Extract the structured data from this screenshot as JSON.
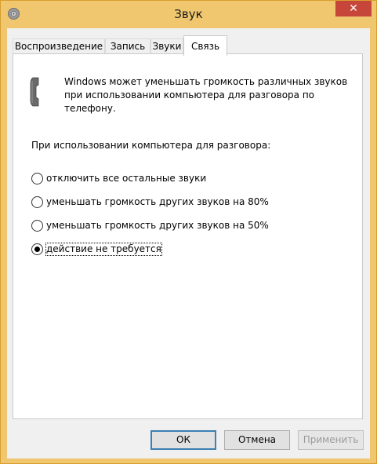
{
  "window": {
    "title": "Звук",
    "close_glyph": "✕",
    "app_icon": "speaker-icon"
  },
  "tabs": [
    {
      "label": "Воспроизведение",
      "active": false
    },
    {
      "label": "Запись",
      "active": false
    },
    {
      "label": "Звуки",
      "active": false
    },
    {
      "label": "Связь",
      "active": true
    }
  ],
  "communications": {
    "phone_icon": "telephone-handset-icon",
    "description_lines": [
      "Windows может уменьшать громкость различных звуков",
      "при использовании компьютера для разговора по",
      "телефону."
    ],
    "prompt": "При использовании компьютера для разговора:",
    "options": [
      {
        "label": "отключить все остальные звуки",
        "selected": false
      },
      {
        "label": "уменьшать громкость других звуков на 80%",
        "selected": false
      },
      {
        "label": "уменьшать громкость других звуков на 50%",
        "selected": false
      },
      {
        "label": "действие не требуется",
        "selected": true
      }
    ]
  },
  "buttons": {
    "ok": "ОК",
    "cancel": "Отмена",
    "apply": "Применить"
  }
}
